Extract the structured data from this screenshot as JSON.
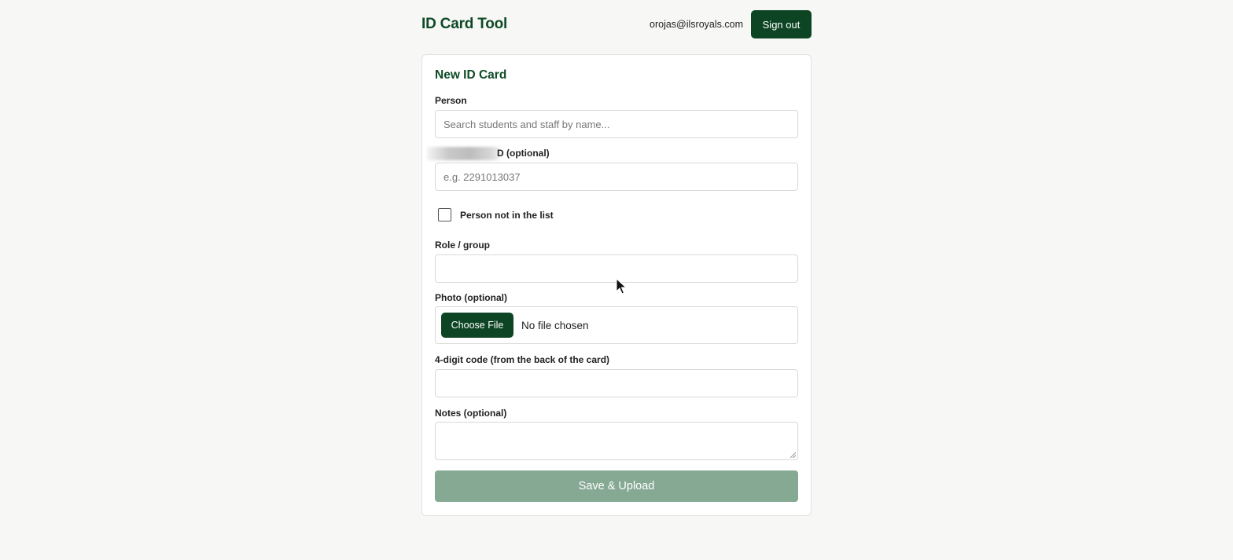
{
  "header": {
    "app_title": "ID Card Tool",
    "user_email": "orojas@ilsroyals.com",
    "signout_label": "Sign out"
  },
  "form": {
    "title": "New ID Card",
    "person": {
      "label": "Person",
      "placeholder": "Search students and staff by name..."
    },
    "id_field": {
      "label_visible": "D (optional)",
      "placeholder": "e.g. 2291013037"
    },
    "not_in_list": {
      "label": "Person not in the list",
      "checked": false
    },
    "role": {
      "label": "Role / group",
      "value": ""
    },
    "photo": {
      "label": "Photo (optional)",
      "button_label": "Choose File",
      "status": "No file chosen"
    },
    "code": {
      "label": "4-digit code (from the back of the card)",
      "value": ""
    },
    "notes": {
      "label": "Notes (optional)",
      "value": ""
    },
    "submit_label": "Save & Upload"
  },
  "colors": {
    "brand_dark": "#0d4423",
    "title_green": "#0f4a26",
    "submit_disabled": "#86a994",
    "page_bg": "#f7f7f5"
  },
  "icons": {
    "cursor": "pointer-arrow-icon"
  }
}
